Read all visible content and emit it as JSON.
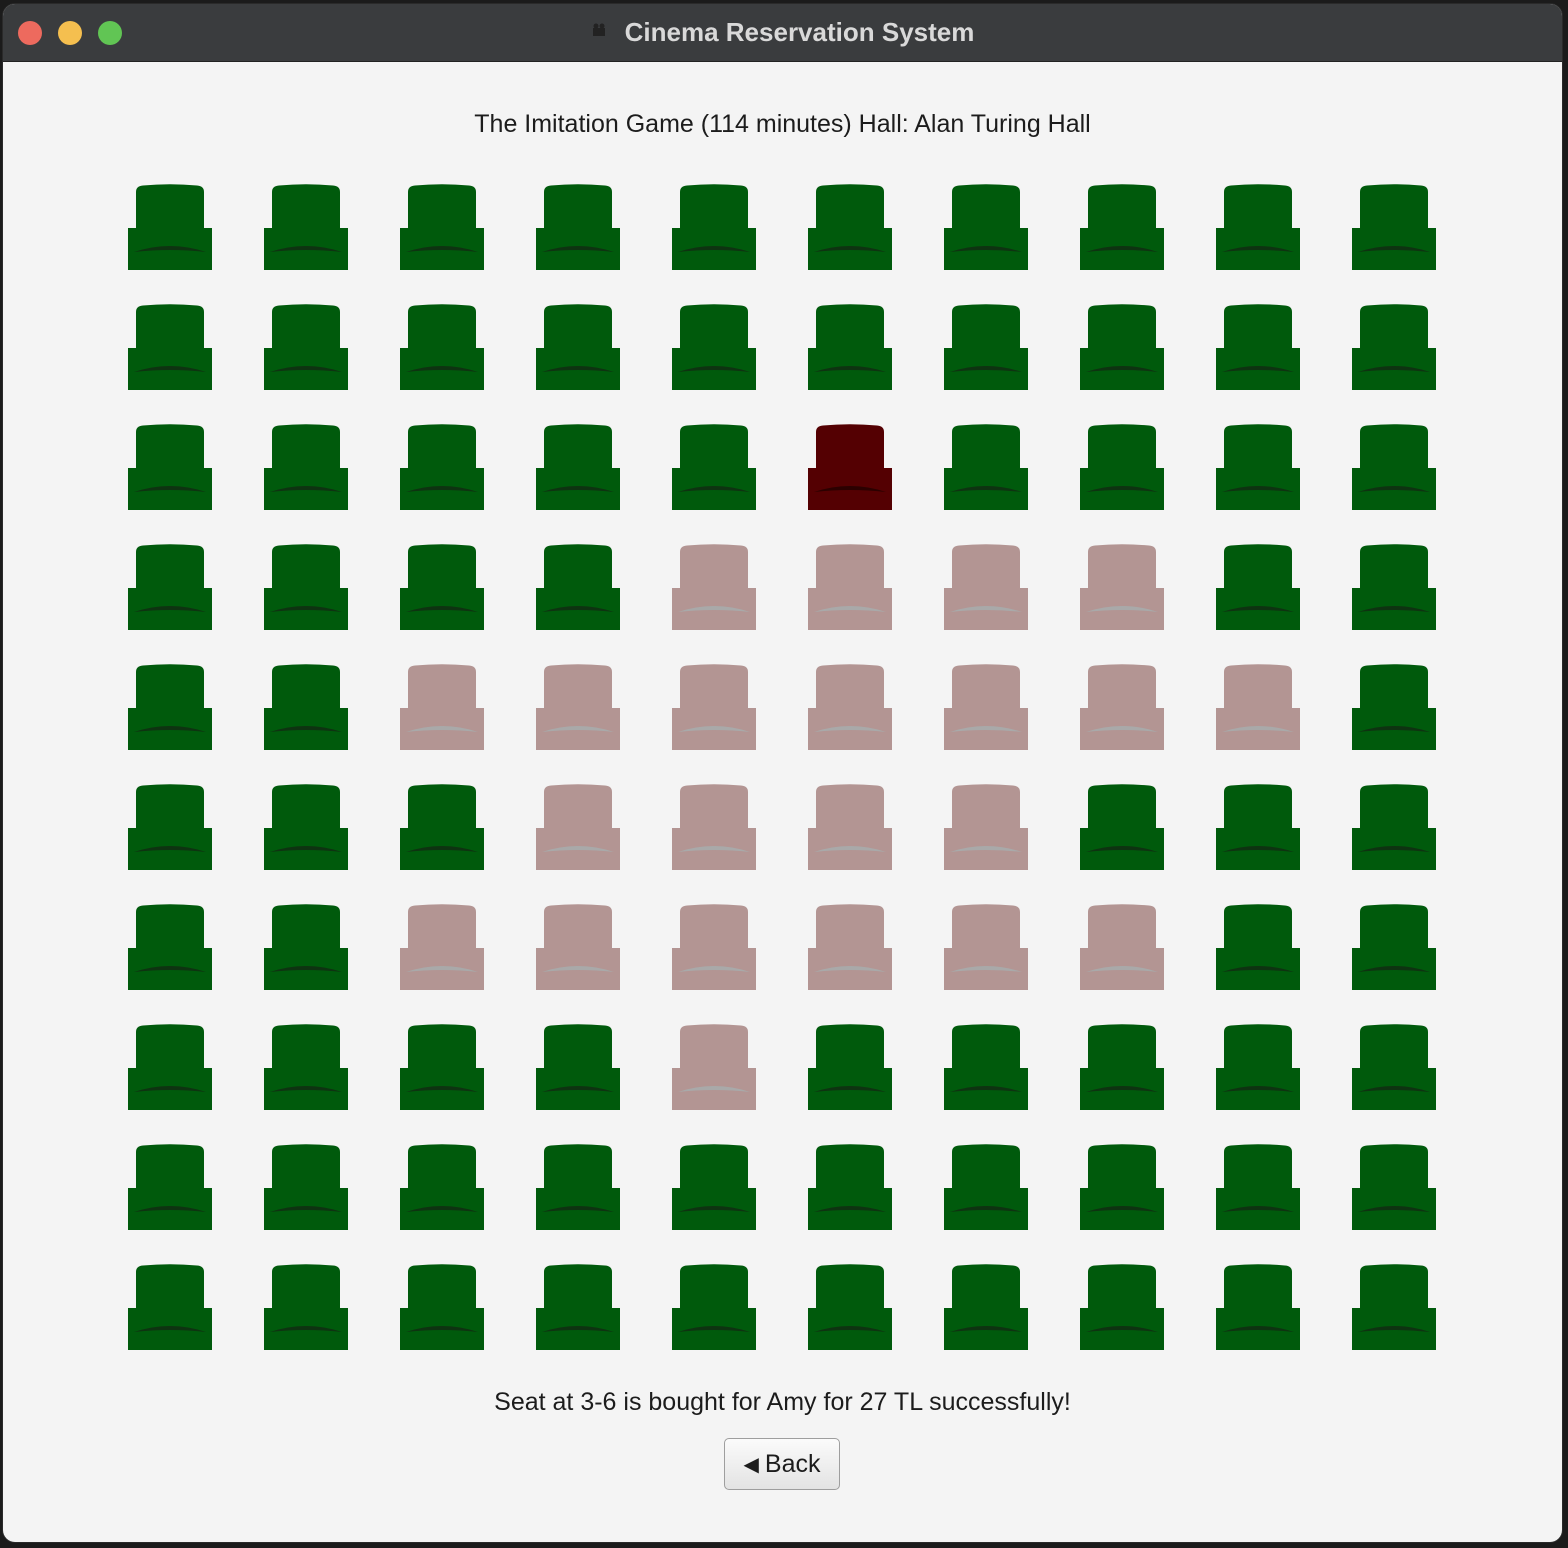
{
  "window": {
    "title": "Cinema Reservation System"
  },
  "header": {
    "movie_info": "The Imitation Game (114 minutes) Hall: Alan Turing Hall"
  },
  "seating": {
    "rows": 10,
    "columns": 10,
    "legend_colors": {
      "available": "#005a0c",
      "available_shadow": "#0e3311",
      "selected": "#540002",
      "selected_shadow": "#2b0000",
      "occupied": "#b39593",
      "occupied_shadow": "#a9a9a9"
    },
    "states": [
      [
        "available",
        "available",
        "available",
        "available",
        "available",
        "available",
        "available",
        "available",
        "available",
        "available"
      ],
      [
        "available",
        "available",
        "available",
        "available",
        "available",
        "available",
        "available",
        "available",
        "available",
        "available"
      ],
      [
        "available",
        "available",
        "available",
        "available",
        "available",
        "selected",
        "available",
        "available",
        "available",
        "available"
      ],
      [
        "available",
        "available",
        "available",
        "available",
        "occupied",
        "occupied",
        "occupied",
        "occupied",
        "available",
        "available"
      ],
      [
        "available",
        "available",
        "occupied",
        "occupied",
        "occupied",
        "occupied",
        "occupied",
        "occupied",
        "occupied",
        "available"
      ],
      [
        "available",
        "available",
        "available",
        "occupied",
        "occupied",
        "occupied",
        "occupied",
        "available",
        "available",
        "available"
      ],
      [
        "available",
        "available",
        "occupied",
        "occupied",
        "occupied",
        "occupied",
        "occupied",
        "occupied",
        "available",
        "available"
      ],
      [
        "available",
        "available",
        "available",
        "available",
        "occupied",
        "available",
        "available",
        "available",
        "available",
        "available"
      ],
      [
        "available",
        "available",
        "available",
        "available",
        "available",
        "available",
        "available",
        "available",
        "available",
        "available"
      ],
      [
        "available",
        "available",
        "available",
        "available",
        "available",
        "available",
        "available",
        "available",
        "available",
        "available"
      ]
    ]
  },
  "status": {
    "message": "Seat at 3-6 is bought for Amy for 27 TL successfully!"
  },
  "actions": {
    "back_icon": "left-triangle-icon",
    "back_label": "Back"
  }
}
